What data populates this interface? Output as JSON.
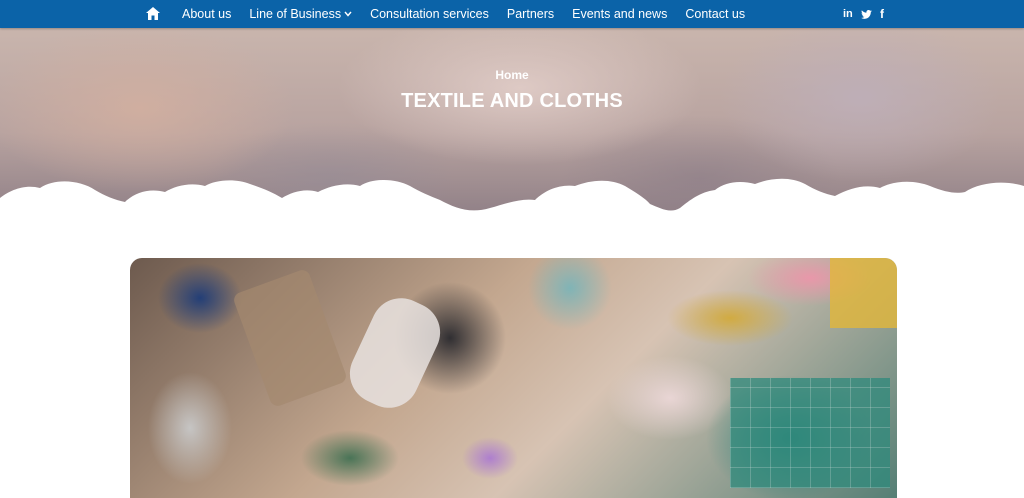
{
  "nav": {
    "home_icon": "home-icon",
    "items": [
      {
        "label": "About us",
        "has_dropdown": false
      },
      {
        "label": "Line of Business",
        "has_dropdown": true
      },
      {
        "label": "Consultation services",
        "has_dropdown": false
      },
      {
        "label": "Partners",
        "has_dropdown": false
      },
      {
        "label": "Events and news",
        "has_dropdown": false
      },
      {
        "label": "Contact us",
        "has_dropdown": false
      }
    ],
    "social": {
      "linkedin_glyph": "in",
      "twitter_icon": "twitter-icon",
      "facebook_glyph": "f"
    }
  },
  "hero": {
    "breadcrumb": "Home",
    "title": "TEXTILE AND CLOTHS"
  },
  "colors": {
    "nav_bg": "#0b63a8",
    "text_on_nav": "#ffffff"
  }
}
